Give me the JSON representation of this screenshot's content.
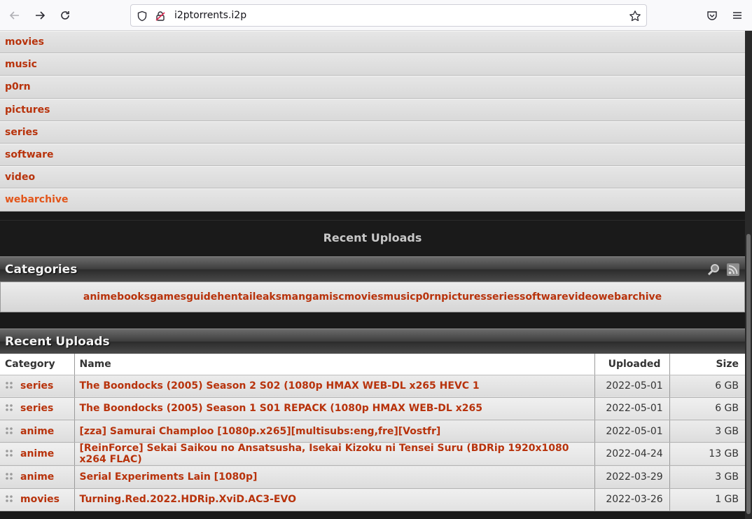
{
  "browser": {
    "url": "i2ptorrents.i2p",
    "icons": [
      "back-icon",
      "forward-icon",
      "reload-icon",
      "shield-icon",
      "lock-broken-icon",
      "star-icon",
      "pocket-icon",
      "menu-icon"
    ]
  },
  "category_list": [
    {
      "label": "movies"
    },
    {
      "label": "music"
    },
    {
      "label": "p0rn"
    },
    {
      "label": "pictures"
    },
    {
      "label": "series"
    },
    {
      "label": "software"
    },
    {
      "label": "video"
    },
    {
      "label": "webarchive"
    }
  ],
  "recent_heading": "Recent Uploads",
  "categories_panel": {
    "title": "Categories",
    "links": [
      "anime",
      "books",
      "games",
      "guide",
      "hentai",
      "leaks",
      "manga",
      "misc",
      "movies",
      "music",
      "p0rn",
      "pictures",
      "series",
      "software",
      "video",
      "webarchive"
    ]
  },
  "uploads_panel": {
    "title": "Recent Uploads",
    "columns": {
      "category": "Category",
      "name": "Name",
      "uploaded": "Uploaded",
      "size": "Size"
    },
    "rows": [
      {
        "category": "series",
        "name": "The Boondocks (2005) Season 2 S02 (1080p HMAX WEB-DL x265 HEVC 1",
        "uploaded": "2022-05-01",
        "size": "6 GB"
      },
      {
        "category": "series",
        "name": "The Boondocks (2005) Season 1 S01 REPACK (1080p HMAX WEB-DL x265",
        "uploaded": "2022-05-01",
        "size": "6 GB"
      },
      {
        "category": "anime",
        "name": "[zza] Samurai Champloo [1080p.x265][multisubs:eng,fre][Vostfr]",
        "uploaded": "2022-05-01",
        "size": "3 GB"
      },
      {
        "category": "anime",
        "name": "[ReinForce] Sekai Saikou no Ansatsusha, Isekai Kizoku ni Tensei Suru (BDRip 1920x1080 x264 FLAC)",
        "uploaded": "2022-04-24",
        "size": "13 GB"
      },
      {
        "category": "anime",
        "name": "Serial Experiments Lain [1080p]",
        "uploaded": "2022-03-29",
        "size": "3 GB"
      },
      {
        "category": "movies",
        "name": "Turning.Red.2022.HDRip.XviD.AC3-EVO",
        "uploaded": "2022-03-26",
        "size": "1 GB"
      }
    ]
  },
  "colors": {
    "link": "#b8330c",
    "link_active": "#e2551a",
    "page_bg": "#1a1a1a"
  }
}
